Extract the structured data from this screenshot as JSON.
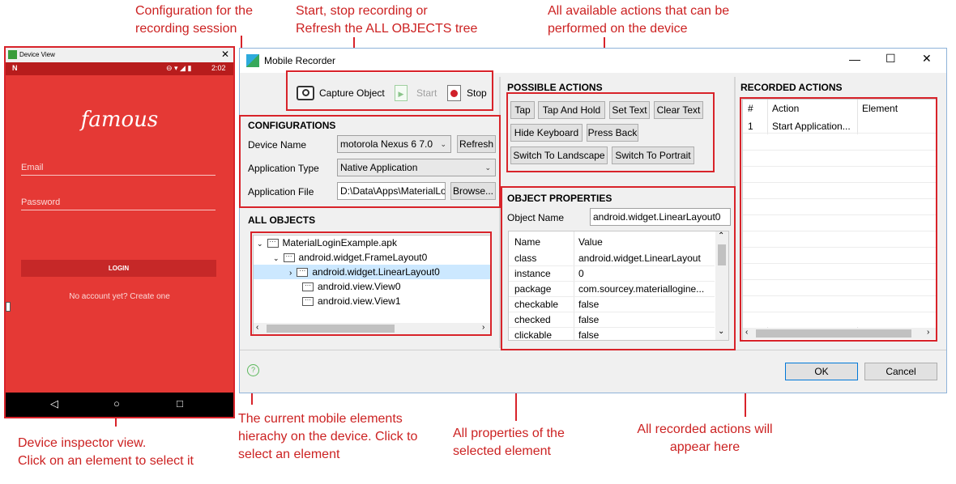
{
  "annotations": {
    "config": "Configuration for the\nrecording session",
    "record": "Start, stop recording or\nRefresh the ALL OBJECTS tree",
    "actions": "All available actions that can be\nperformed on the device",
    "device": "Device inspector view.\nClick on an element to select it",
    "hierarchy": "The current mobile elements\nhierachy on the device. Click to\nselect an element",
    "properties": "All properties of the\nselected element",
    "recorded": "All recorded actions will\nappear here"
  },
  "device": {
    "window_title": "Device View",
    "status_left": "N",
    "time": "2:02",
    "logo": "famous",
    "email_placeholder": "Email",
    "password_placeholder": "Password",
    "login_label": "LOGIN",
    "signup_text": "No account yet? Create one"
  },
  "recorder": {
    "window_title": "Mobile Recorder",
    "toolbar": {
      "capture": "Capture Object",
      "start": "Start",
      "stop": "Stop"
    },
    "configurations": {
      "title": "CONFIGURATIONS",
      "device_name_label": "Device Name",
      "device_name_value": "motorola Nexus 6 7.0",
      "refresh": "Refresh",
      "app_type_label": "Application Type",
      "app_type_value": "Native Application",
      "app_file_label": "Application File",
      "app_file_value": "D:\\Data\\Apps\\MaterialLoginExample.apk",
      "browse": "Browse..."
    },
    "all_objects": {
      "title": "ALL OBJECTS",
      "nodes": [
        "MaterialLoginExample.apk",
        "android.widget.FrameLayout0",
        "android.widget.LinearLayout0",
        "android.view.View0",
        "android.view.View1"
      ]
    },
    "possible_actions": {
      "title": "POSSIBLE ACTIONS",
      "buttons": [
        "Tap",
        "Tap And Hold",
        "Set Text",
        "Clear Text",
        "Hide Keyboard",
        "Press Back",
        "Switch To Landscape",
        "Switch To Portrait"
      ]
    },
    "object_properties": {
      "title": "OBJECT PROPERTIES",
      "object_name_label": "Object Name",
      "object_name_value": "android.widget.LinearLayout0",
      "col_name": "Name",
      "col_value": "Value",
      "rows": [
        [
          "class",
          "android.widget.LinearLayout"
        ],
        [
          "instance",
          "0"
        ],
        [
          "package",
          "com.sourcey.materiallogine..."
        ],
        [
          "checkable",
          "false"
        ],
        [
          "checked",
          "false"
        ],
        [
          "clickable",
          "false"
        ]
      ]
    },
    "recorded_actions": {
      "title": "RECORDED ACTIONS",
      "col_num": "#",
      "col_action": "Action",
      "col_element": "Element",
      "rows": [
        [
          "1",
          "Start Application...",
          ""
        ]
      ]
    },
    "ok": "OK",
    "cancel": "Cancel"
  },
  "colors": {
    "annotation": "#cc2222",
    "device_red": "#e53935",
    "window_border": "#8fb3d9"
  }
}
